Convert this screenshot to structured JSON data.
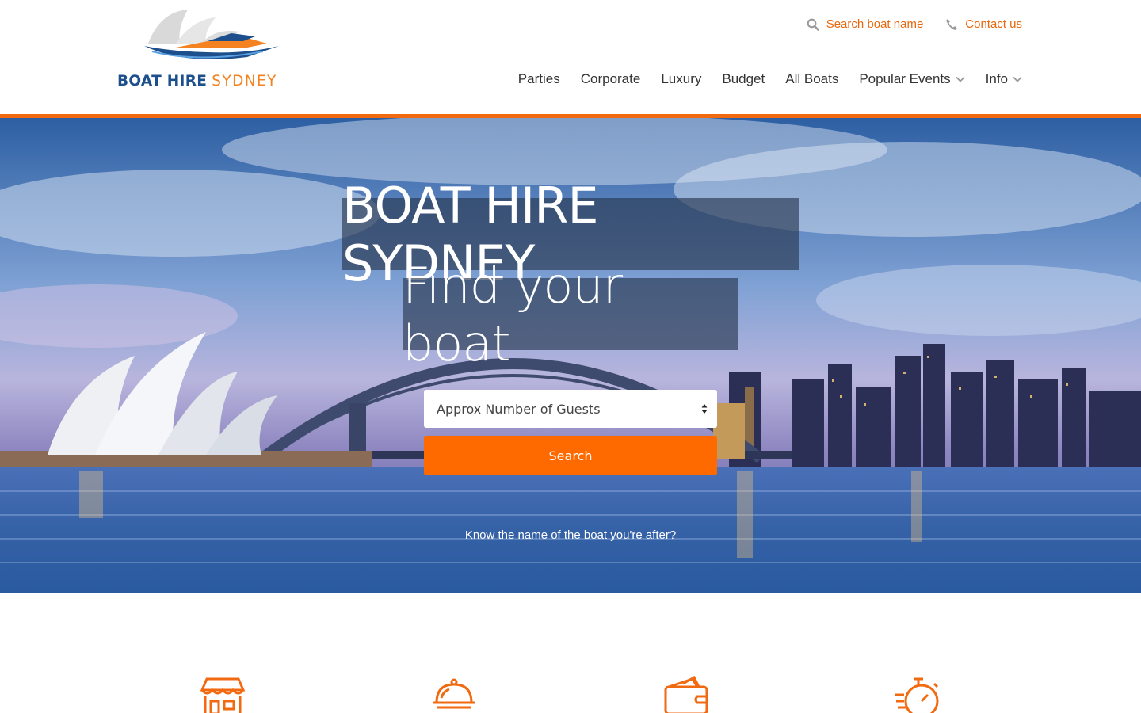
{
  "brand": {
    "name_part1": "BOAT HIRE",
    "name_part2": "SYDNEY",
    "primary_color": "#1d4f8c",
    "accent_color": "#f58220"
  },
  "utility": {
    "search_icon": "search-icon",
    "search_label": "Search boat name",
    "contact_icon": "phone-icon",
    "contact_label": "Contact us"
  },
  "nav": {
    "items": [
      {
        "label": "Parties"
      },
      {
        "label": "Corporate"
      },
      {
        "label": "Luxury"
      },
      {
        "label": "Budget"
      },
      {
        "label": "All Boats"
      },
      {
        "label": "Popular Events",
        "dropdown": true
      },
      {
        "label": "Info",
        "dropdown": true
      }
    ]
  },
  "hero": {
    "title": "BOAT HIRE SYDNEY",
    "subtitle": "Find your boat",
    "guests_select": {
      "selected": "Approx Number of Guests"
    },
    "search_button": "Search",
    "know_name_link": "Know the name of the boat you're after?"
  },
  "features": {
    "icons": [
      "storefront-icon",
      "serving-cloche-icon",
      "wallet-icon",
      "stopwatch-icon"
    ],
    "icon_color": "#f26a10"
  },
  "colors": {
    "accent": "#ff6a00",
    "link": "#e8670c",
    "rule": "#f26a10"
  }
}
